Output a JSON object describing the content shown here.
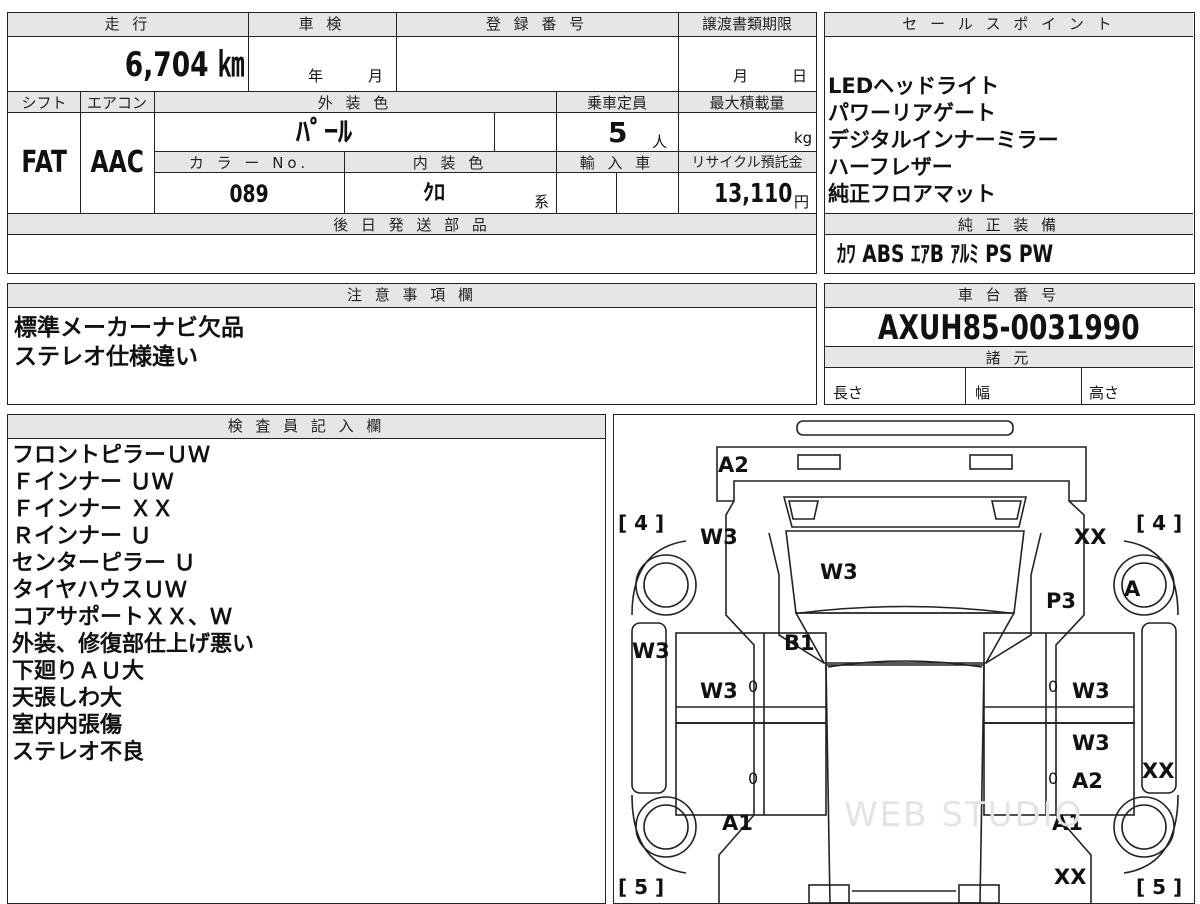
{
  "top_row": {
    "mileage": {
      "label": "走 行",
      "value": "6,704 ㎞"
    },
    "inspection": {
      "label": "車 検",
      "year_unit": "年",
      "month_unit": "月"
    },
    "registration": {
      "label": "登 録 番 号",
      "value": ""
    },
    "transfer_deadline": {
      "label": "譲渡書類期限",
      "month_unit": "月",
      "day_unit": "日"
    }
  },
  "second_row": {
    "shift": {
      "label": "シフト",
      "value": "FAT"
    },
    "aircon": {
      "label": "エアコン",
      "value": "AAC"
    },
    "exterior_color": {
      "label": "外 装 色",
      "value": "ﾊﾟｰﾙ"
    },
    "capacity": {
      "label": "乗車定員",
      "value": "5",
      "unit": "人"
    },
    "max_load": {
      "label": "最大積載量",
      "value": "",
      "unit": "kg"
    },
    "color_no": {
      "label": "カ ラ ー No.",
      "value": "089"
    },
    "interior_color": {
      "label": "内 装 色",
      "value": "ｸﾛ",
      "suffix": "系"
    },
    "import": {
      "label": "輸 入 車",
      "value": ""
    },
    "recycle_fee": {
      "label": "リサイクル預託金",
      "value": "13,110",
      "unit": "円"
    }
  },
  "later_parts": {
    "label": "後 日 発 送 部 品",
    "value": ""
  },
  "sales_points": {
    "label": "セ ー ル ス ポ イ ン ト",
    "items": [
      "LEDヘッドライト",
      "パワーリアゲート",
      "デジタルインナーミラー",
      "ハーフレザー",
      "純正フロアマット"
    ]
  },
  "genuine_equipment": {
    "label": "純 正 装 備",
    "value": "ｶﾜ ABS ｴｱB ｱﾙﾐ PS PW"
  },
  "notes": {
    "label": "注 意 事 項 欄",
    "items": [
      "標準メーカーナビ欠品",
      "ステレオ仕様違い"
    ]
  },
  "chassis": {
    "label": "車 台 番 号",
    "value": "AXUH85-0031990"
  },
  "specs": {
    "label": "諸 元",
    "length": "長さ",
    "width": "幅",
    "height": "高さ"
  },
  "inspector": {
    "label": "検 査 員 記 入 欄",
    "items": [
      "フロントピラーＵＷ",
      "Ｆインナー ＵＷ",
      "Ｆインナー ＸＸ",
      "Ｒインナー Ｕ",
      "センターピラー Ｕ",
      "タイヤハウスＵＷ",
      "コアサポートＸＸ、Ｗ",
      "外装、修復部仕上げ悪い",
      "下廻りＡＵ大",
      "天張しわ大",
      "室内内張傷",
      "ステレオ不良"
    ]
  },
  "diagram": {
    "marks": {
      "a2_top": "A2",
      "w3_left_front": "W3",
      "xx_right_front": "XX",
      "w3_hood": "W3",
      "p3_right": "P3",
      "w3_left_fender": "W3",
      "b1": "B1",
      "w3_left_door": "W3",
      "w3_right_door": "W3",
      "w3_right_rdoor": "W3",
      "a2_right": "A2",
      "xx_right_side": "XX",
      "a1_left": "A1",
      "a1_right": "A1",
      "xx_right_rear": "XX",
      "a_tire": "A",
      "zero1": "0",
      "zero2": "0",
      "zero3": "0",
      "zero4": "0"
    },
    "tires": {
      "fl": "[ 4 ]",
      "fr": "[ 4 ]",
      "rl": "[ 5 ]",
      "rr": "[ 5 ]"
    },
    "watermark": "WEB STUDIO"
  }
}
